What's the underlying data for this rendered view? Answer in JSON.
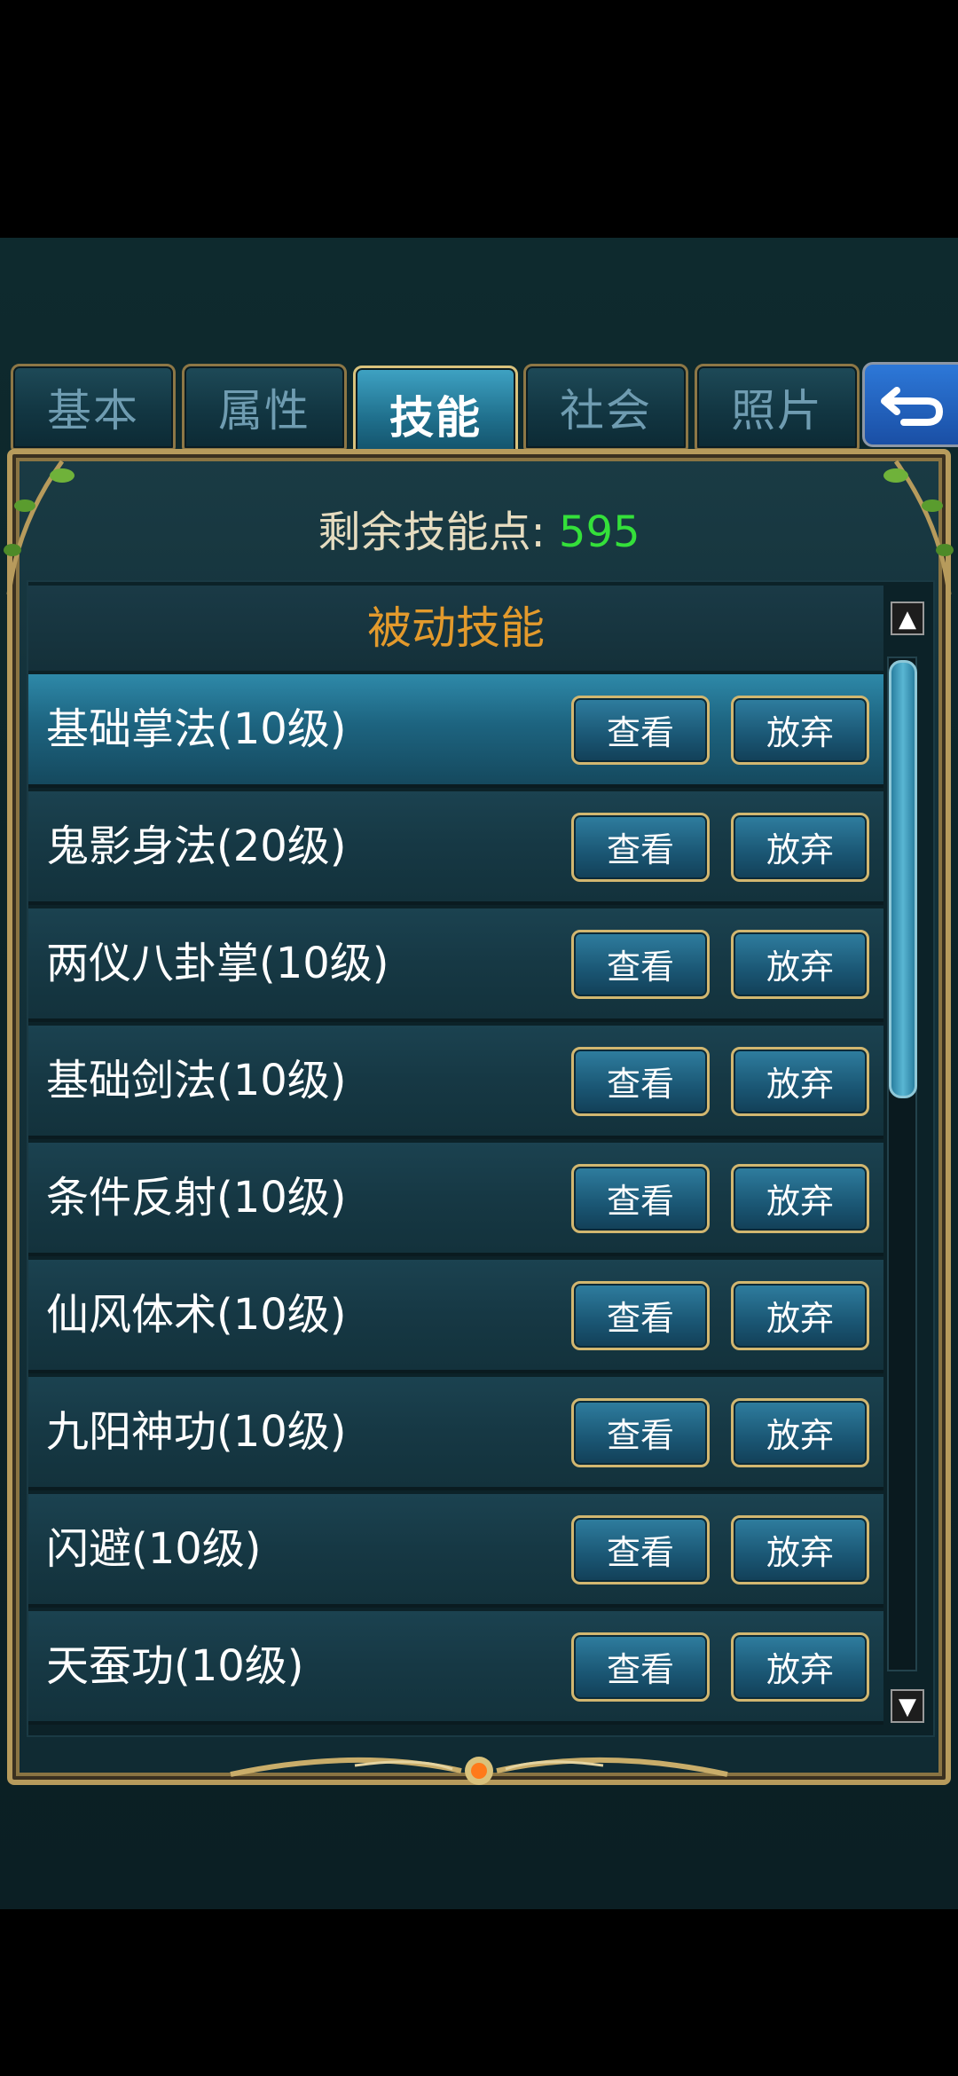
{
  "tabs": [
    "基本",
    "属性",
    "技能",
    "社会",
    "照片"
  ],
  "active_tab": "技能",
  "back_icon": "return-arrow-icon",
  "skill_points": {
    "label": "剩余技能点:",
    "value": "595"
  },
  "section_title": "被动技能",
  "buttons": {
    "view": "查看",
    "drop": "放弃"
  },
  "skills": [
    "基础掌法(10级)",
    "鬼影身法(20级)",
    "两仪八卦掌(10级)",
    "基础剑法(10级)",
    "条件反射(10级)",
    "仙风体术(10级)",
    "九阳神功(10级)",
    "闪避(10级)",
    "天蚕功(10级)"
  ],
  "scroll": {
    "up_icon": "▲",
    "down_icon": "▼"
  },
  "colors": {
    "points": "#34e03a",
    "section": "#e39a2c",
    "gold_border": "#d2b770"
  }
}
